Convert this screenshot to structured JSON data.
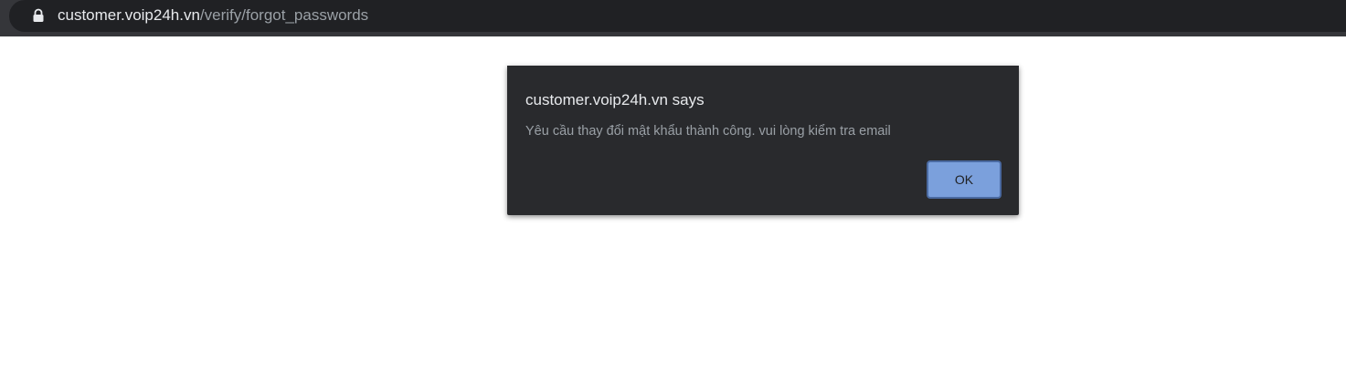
{
  "browser": {
    "url_host": "customer.voip24h.vn",
    "url_path": "/verify/forgot_passwords",
    "lock_icon": "lock-icon"
  },
  "dialog": {
    "title": "customer.voip24h.vn says",
    "message": "Yêu cầu thay đổi mật khẩu thành công. vui lòng kiểm tra email",
    "ok_label": "OK"
  },
  "colors": {
    "dialog_bg": "#292a2d",
    "ok_button_bg": "#7ba0dc"
  }
}
